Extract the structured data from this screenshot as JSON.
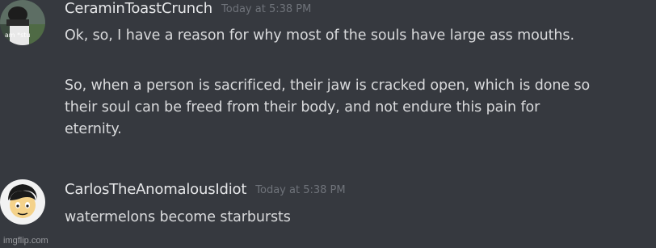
{
  "messages": [
    {
      "username": "CeraminToastCrunch",
      "timestamp": "Today at 5:38 PM",
      "avatar_text": "I am *stu",
      "lines": [
        "Ok, so, I have a reason for why most of the souls have large ass mouths.",
        "So, when a person is sacrificed, their jaw is cracked open, which is done so",
        "their soul can be freed from their body, and not endure this pain for",
        "eternity."
      ]
    },
    {
      "username": "CarlosTheAnomalousIdiot",
      "timestamp": "Today at 5:38 PM",
      "lines": [
        "watermelons become starbursts"
      ]
    }
  ],
  "watermark": "imgflip.com"
}
